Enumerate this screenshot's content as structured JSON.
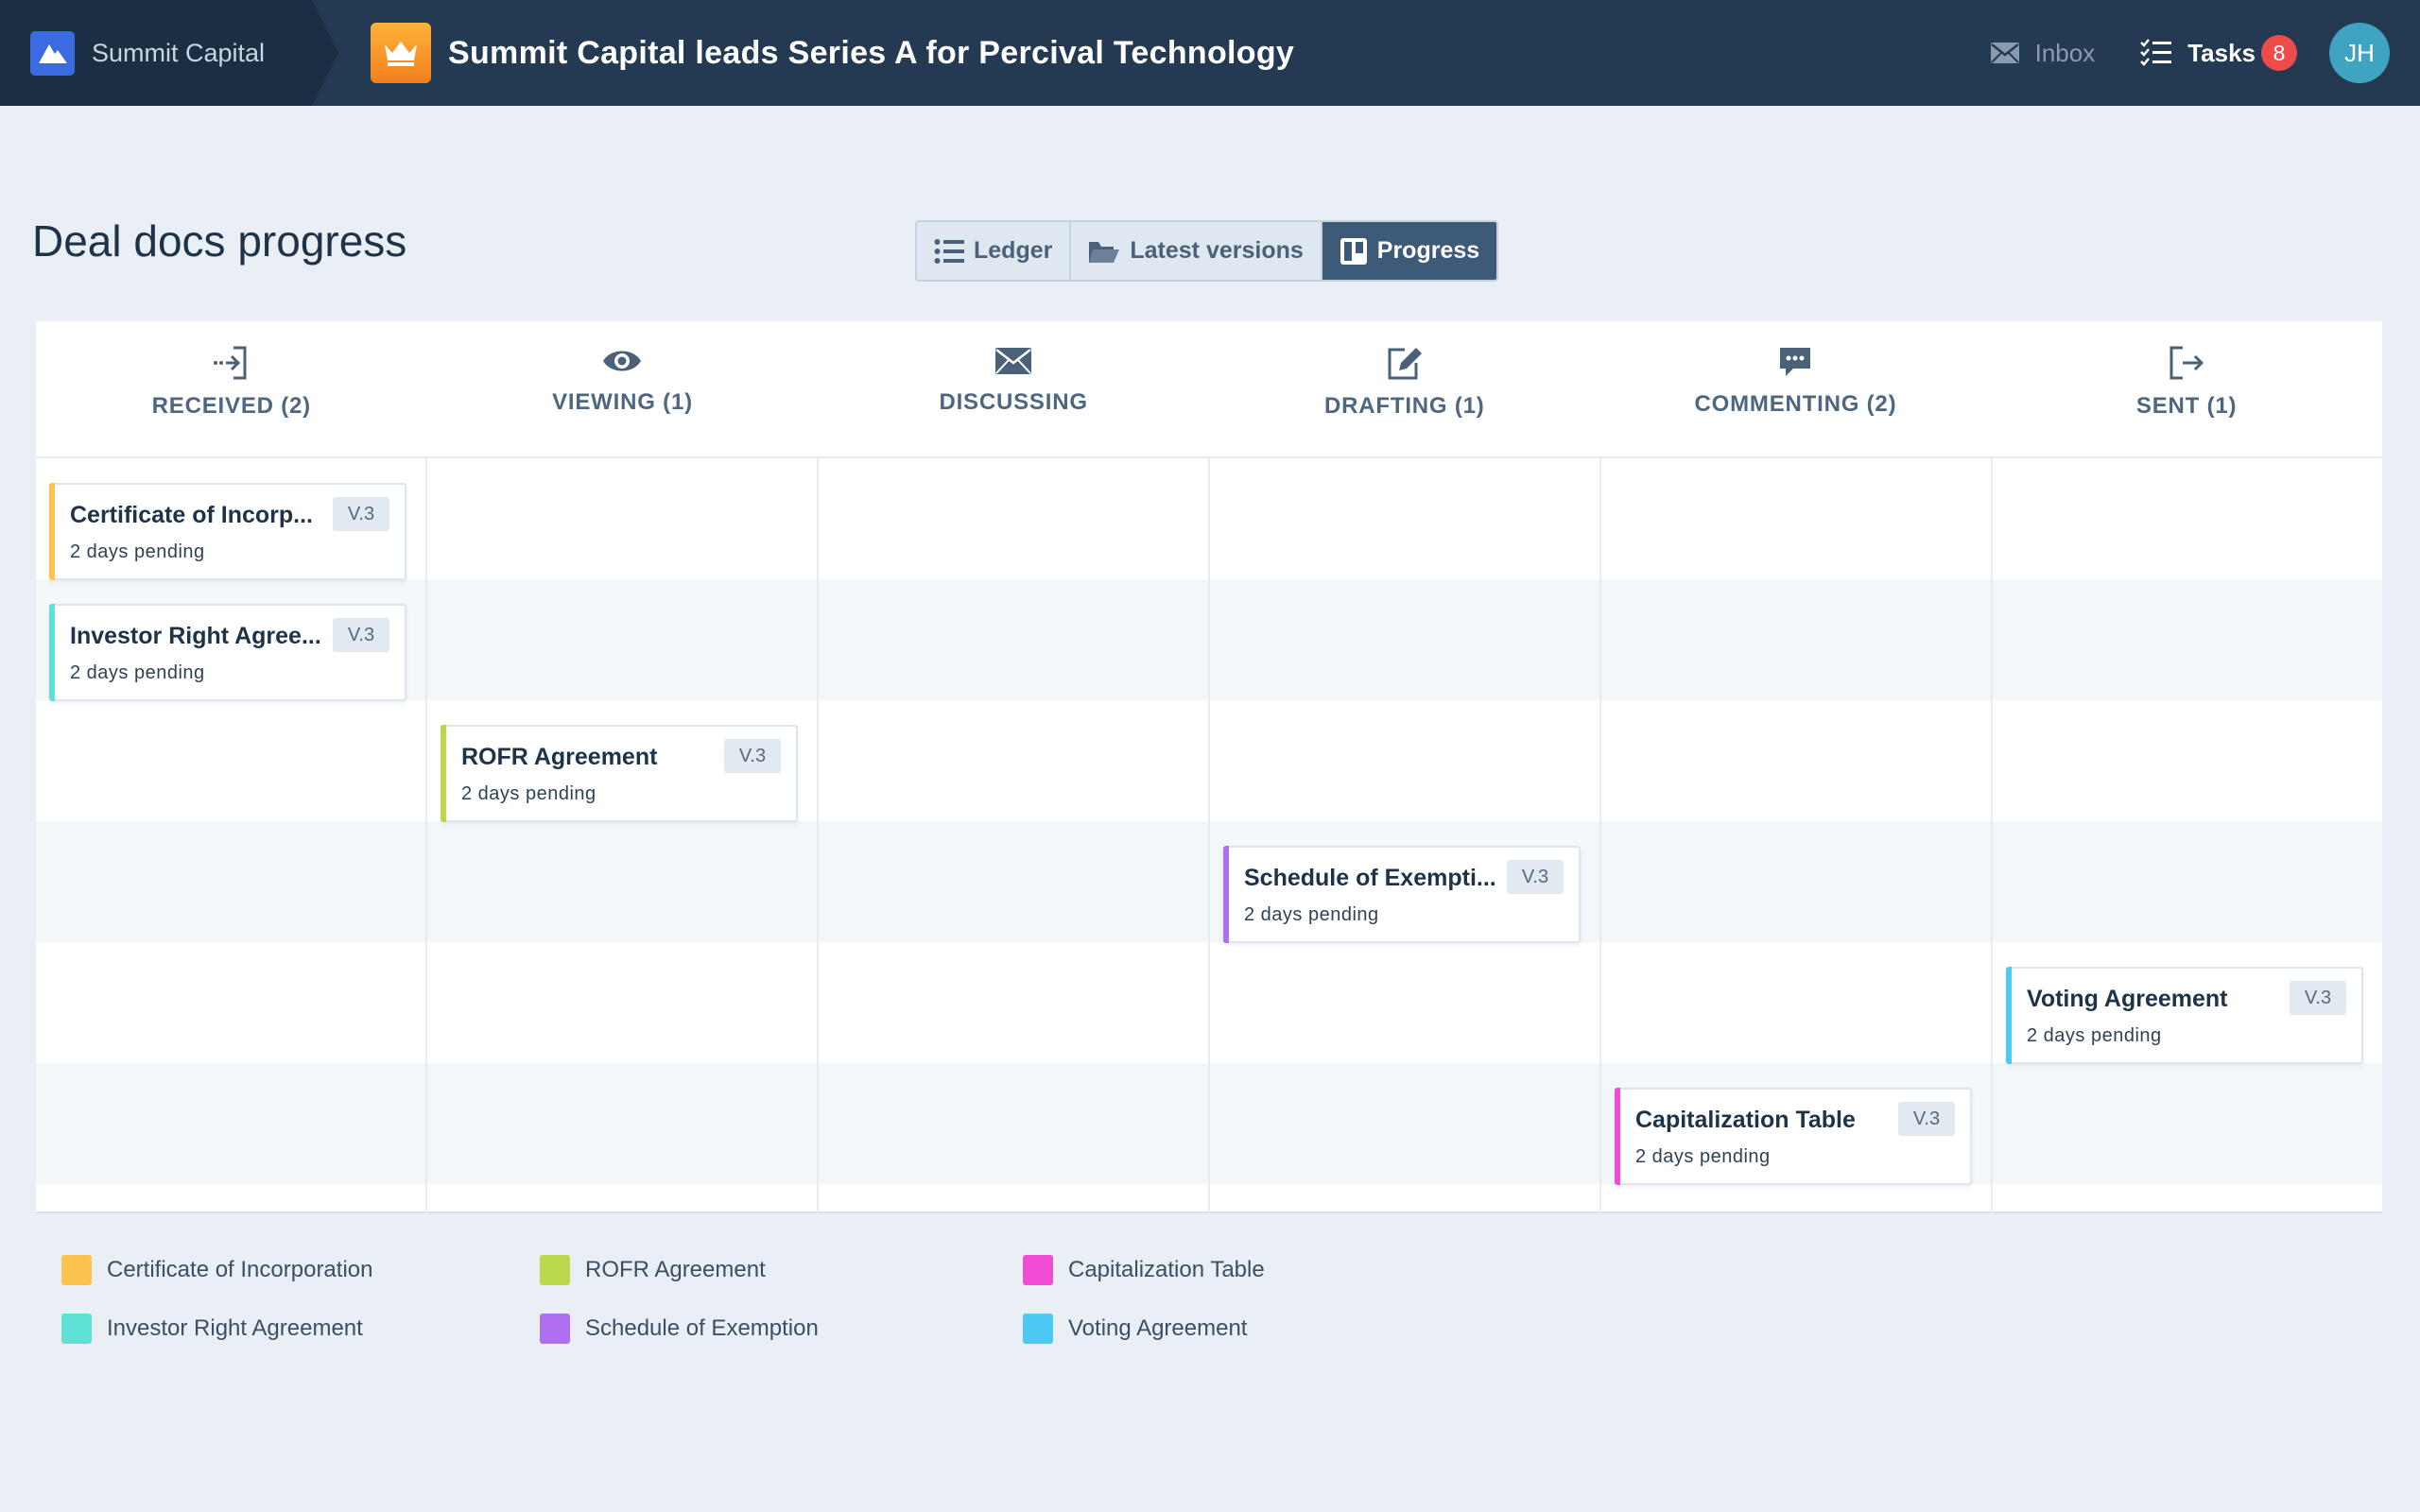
{
  "topbar": {
    "org_name": "Summit Capital",
    "deal_title": "Summit Capital leads Series A for Percival Technology",
    "inbox_label": "Inbox",
    "tasks_label": "Tasks",
    "tasks_count": "8",
    "avatar_initials": "JH"
  },
  "page": {
    "title": "Deal docs progress",
    "views": [
      "Ledger",
      "Latest versions",
      "Progress"
    ],
    "active_view": "Progress"
  },
  "stages": [
    {
      "label": "RECEIVED (2)",
      "icon": "sign-in-icon"
    },
    {
      "label": "VIEWING (1)",
      "icon": "eye-icon"
    },
    {
      "label": "DISCUSSING",
      "icon": "envelope-icon"
    },
    {
      "label": "DRAFTING (1)",
      "icon": "edit-icon"
    },
    {
      "label": "COMMENTING (2)",
      "icon": "comment-icon"
    },
    {
      "label": "SENT (1)",
      "icon": "sign-out-icon"
    }
  ],
  "cards": [
    {
      "title": "Certificate of Incorporation",
      "display_title": "Certificate of Incorp...",
      "status": "2 days pending",
      "version": "V.3",
      "color": "#fcc34e"
    },
    {
      "title": "Investor Right Agreement",
      "display_title": "Investor Right Agree...",
      "status": "2 days pending",
      "version": "V.3",
      "color": "#5ee2d6"
    },
    {
      "title": "ROFR Agreement",
      "display_title": "ROFR Agreement",
      "status": "2 days pending",
      "version": "V.3",
      "color": "#b9d84a"
    },
    {
      "title": "Schedule of Exemption",
      "display_title": "Schedule of Exempti...",
      "status": "2 days pending",
      "version": "V.3",
      "color": "#b06ef0"
    },
    {
      "title": "Voting Agreement",
      "display_title": "Voting Agreement",
      "status": "2 days pending",
      "version": "V.3",
      "color": "#4dc9f3"
    },
    {
      "title": "Capitalization Table",
      "display_title": "Capitalization Table",
      "status": "2 days pending",
      "version": "V.3",
      "color": "#f04bd3"
    }
  ],
  "legend": [
    {
      "label": "Certificate of Incorporation",
      "color": "#fcc34e"
    },
    {
      "label": "ROFR Agreement",
      "color": "#b9d84a"
    },
    {
      "label": "Capitalization Table",
      "color": "#f04bd3"
    },
    {
      "label": "Investor Right Agreement",
      "color": "#5ee2d6"
    },
    {
      "label": "Schedule of Exemption",
      "color": "#b06ef0"
    },
    {
      "label": "Voting Agreement",
      "color": "#4dc9f3"
    }
  ]
}
